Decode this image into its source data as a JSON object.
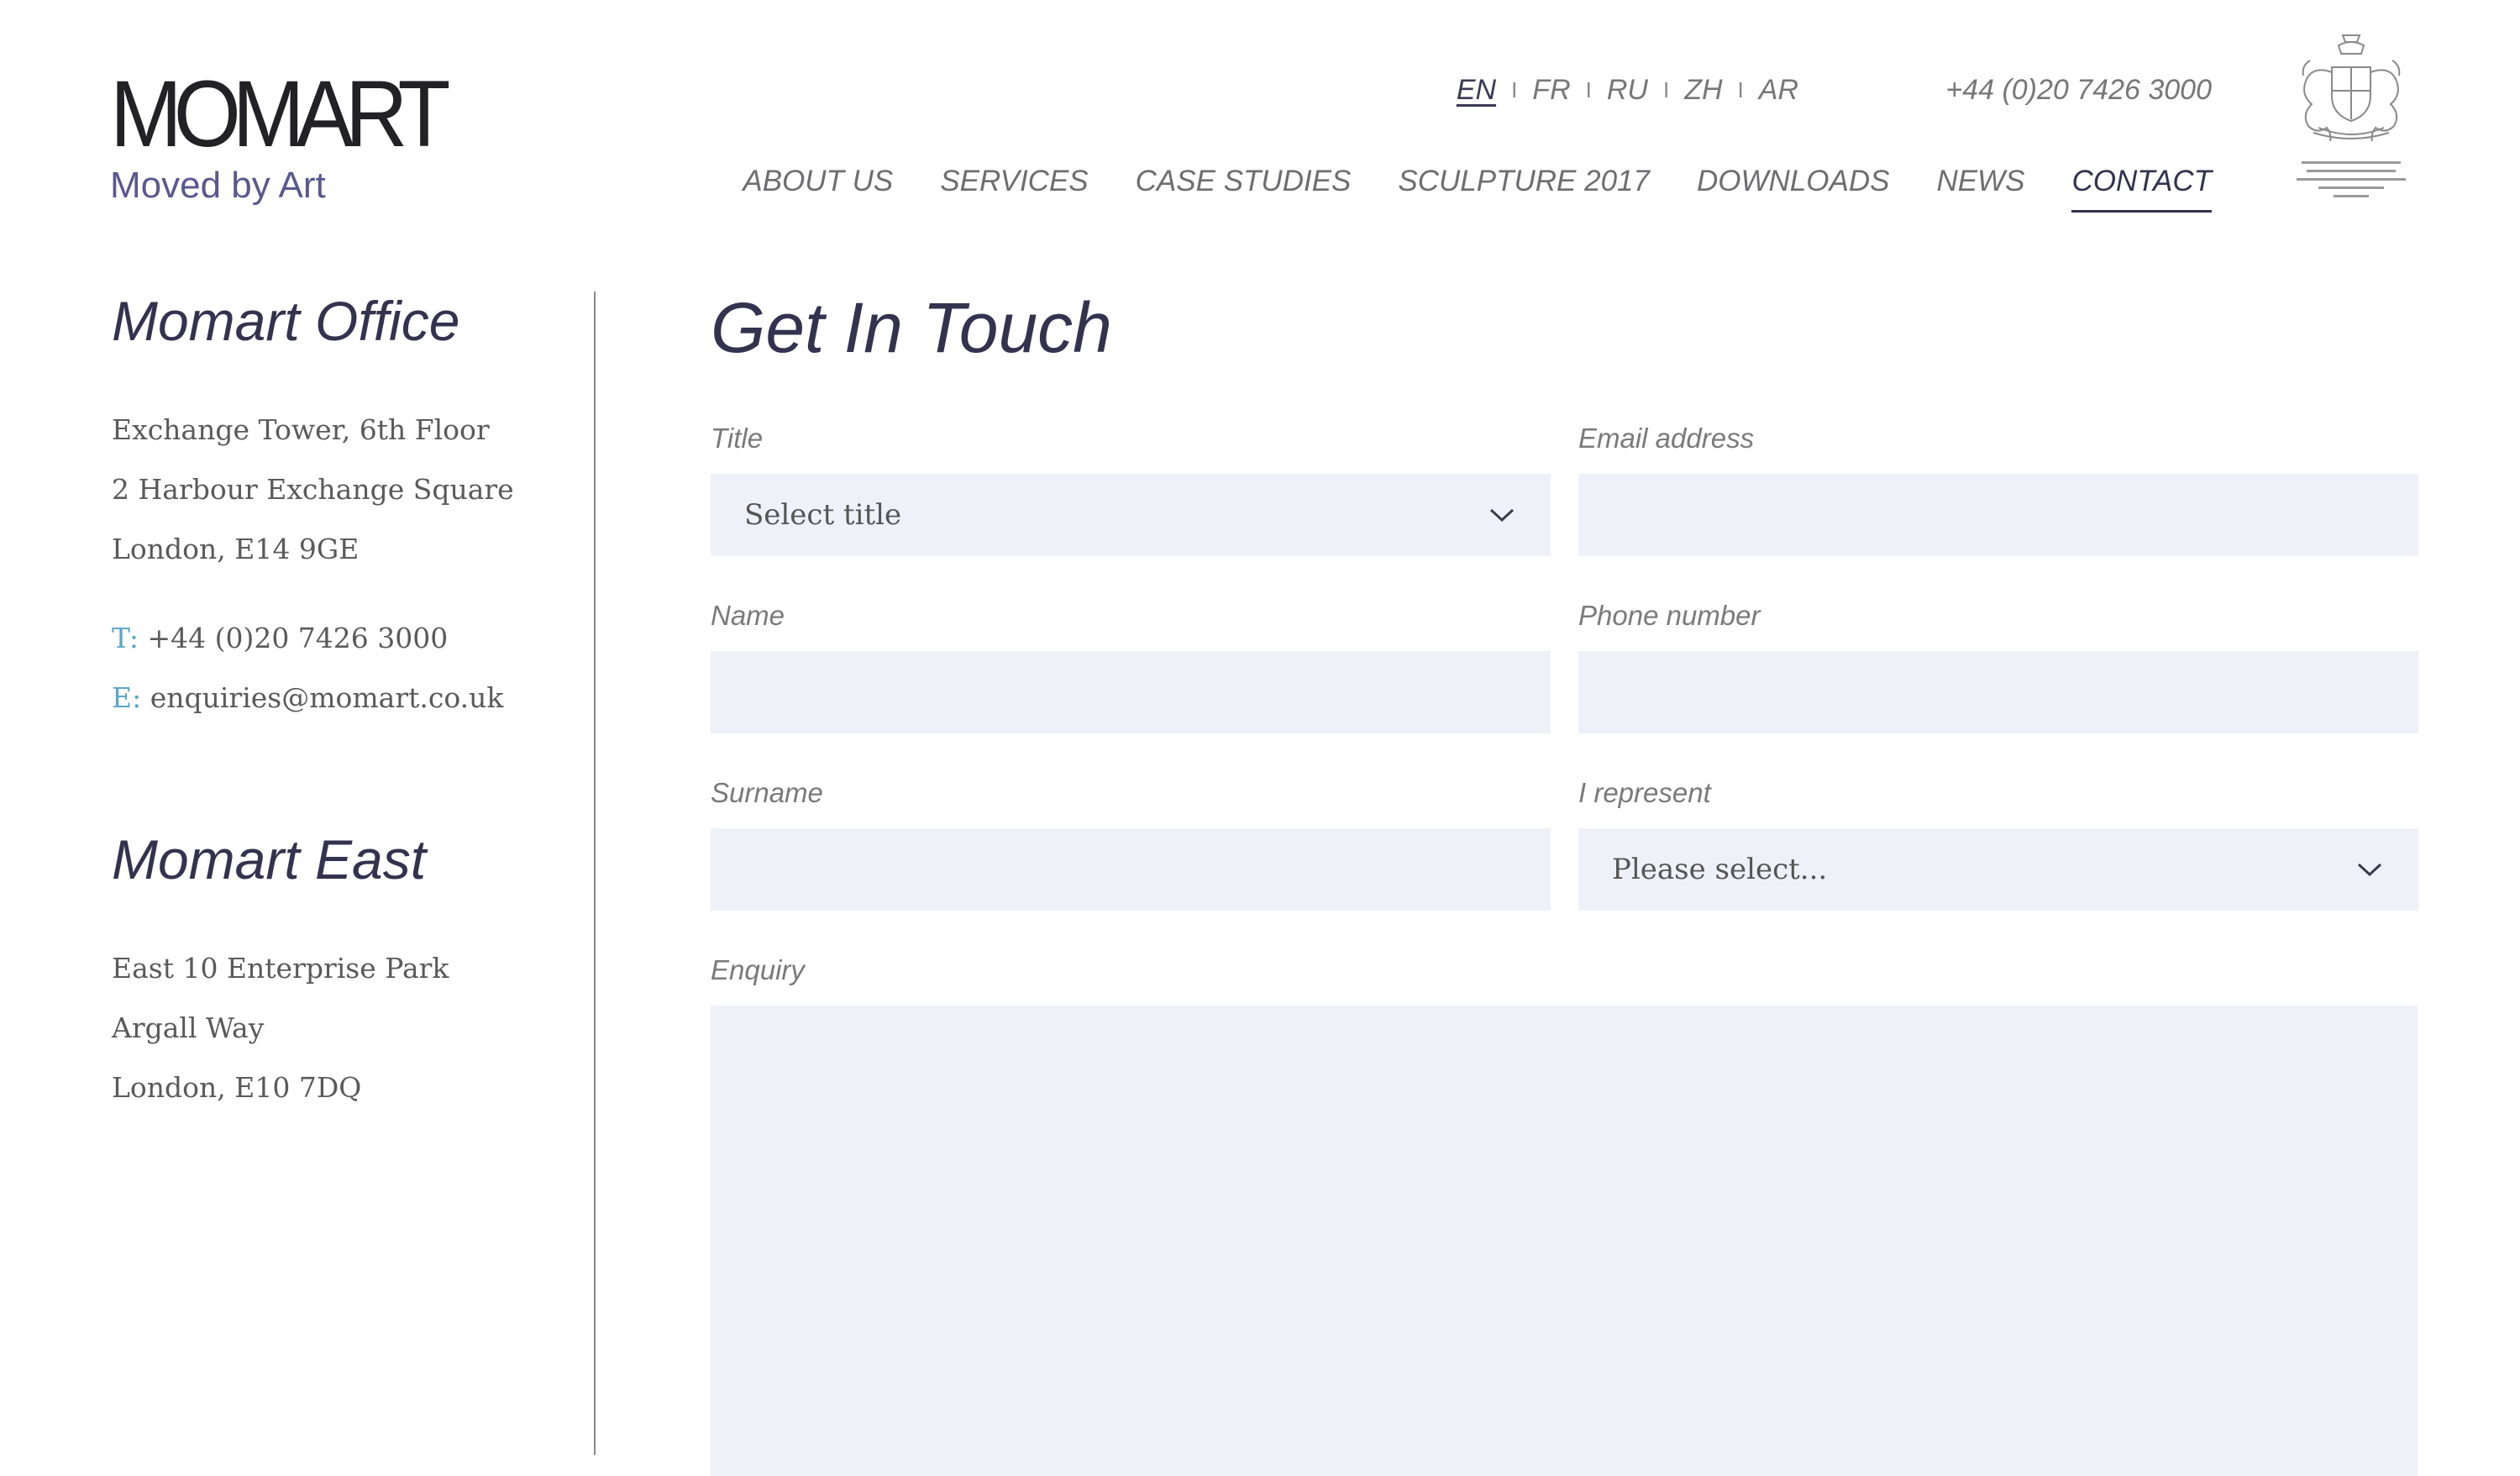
{
  "logo": {
    "wordmark": "MOMART",
    "tagline": "Moved by Art"
  },
  "languages": [
    {
      "code": "EN",
      "active": true
    },
    {
      "code": "FR",
      "active": false
    },
    {
      "code": "RU",
      "active": false
    },
    {
      "code": "ZH",
      "active": false
    },
    {
      "code": "AR",
      "active": false
    }
  ],
  "language_separator": "I",
  "header_phone": "+44 (0)20 7426 3000",
  "nav": [
    {
      "label": "ABOUT US",
      "active": false
    },
    {
      "label": "SERVICES",
      "active": false
    },
    {
      "label": "CASE STUDIES",
      "active": false
    },
    {
      "label": "SCULPTURE 2017",
      "active": false
    },
    {
      "label": "DOWNLOADS",
      "active": false
    },
    {
      "label": "NEWS",
      "active": false
    },
    {
      "label": "CONTACT",
      "active": true
    }
  ],
  "crest_icon": "royal-warrant-crest-icon",
  "offices": [
    {
      "heading": "Momart Office",
      "address": [
        "Exchange Tower, 6th Floor",
        "2 Harbour Exchange Square",
        "London, E14 9GE"
      ],
      "phone_prefix": "T:",
      "phone": "+44 (0)20 7426 3000",
      "email_prefix": "E:",
      "email": "enquiries@momart.co.uk"
    },
    {
      "heading": "Momart East",
      "address": [
        "East 10 Enterprise Park",
        "Argall Way",
        "London, E10 7DQ"
      ]
    }
  ],
  "form": {
    "heading": "Get In Touch",
    "title_label": "Title",
    "title_value": "Select title",
    "email_label": "Email address",
    "email_value": "",
    "name_label": "Name",
    "name_value": "",
    "phone_label": "Phone number",
    "phone_value": "",
    "surname_label": "Surname",
    "surname_value": "",
    "represent_label": "I represent",
    "represent_value": "Please select...",
    "enquiry_label": "Enquiry",
    "enquiry_value": ""
  },
  "colors": {
    "accent_text": "#33334f",
    "field_background": "#eef1f8",
    "contact_prefix": "#5aa6c8",
    "tagline": "#5b5890"
  }
}
